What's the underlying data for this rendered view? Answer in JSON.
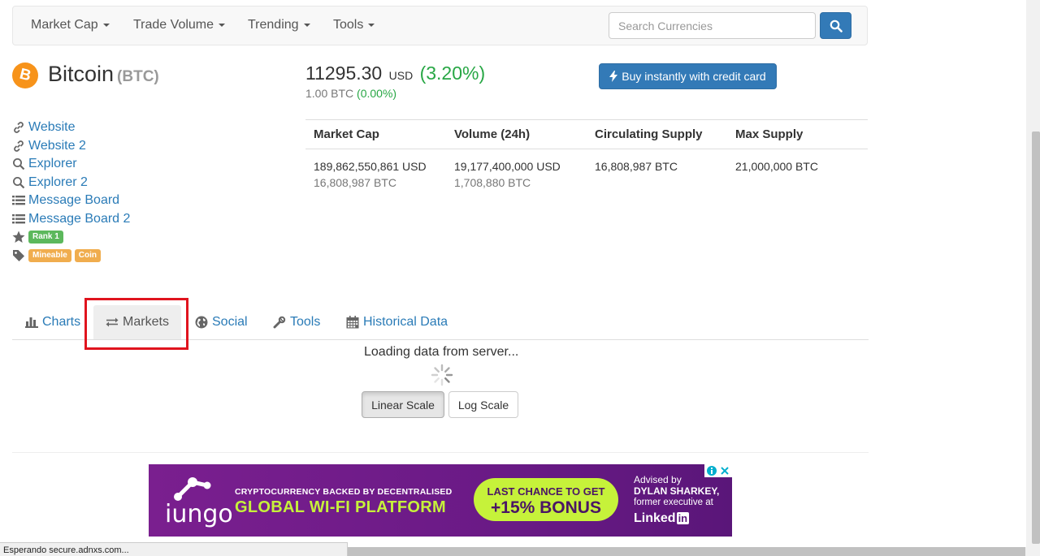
{
  "navbar": {
    "items": [
      {
        "label": "Market Cap"
      },
      {
        "label": "Trade Volume"
      },
      {
        "label": "Trending"
      },
      {
        "label": "Tools"
      }
    ],
    "search_placeholder": "Search Currencies"
  },
  "coin": {
    "name": "Bitcoin",
    "symbol": "(BTC)",
    "logo_color": "#f7931a"
  },
  "links": [
    {
      "label": "Website",
      "icon": "link-icon"
    },
    {
      "label": "Website 2",
      "icon": "link-icon"
    },
    {
      "label": "Explorer",
      "icon": "search-icon"
    },
    {
      "label": "Explorer 2",
      "icon": "search-icon"
    },
    {
      "label": "Message Board",
      "icon": "list-icon"
    },
    {
      "label": "Message Board 2",
      "icon": "list-icon"
    }
  ],
  "badges": {
    "rank": "Rank 1",
    "tags": [
      "Mineable",
      "Coin"
    ]
  },
  "price": {
    "value": "11295.30",
    "currency": "USD",
    "change": "(3.20%)",
    "btc_value": "1.00 BTC",
    "btc_change": "(0.00%)"
  },
  "buy_button": "Buy instantly with credit card",
  "stats": {
    "headers": [
      "Market Cap",
      "Volume (24h)",
      "Circulating Supply",
      "Max Supply"
    ],
    "market_cap_usd": "189,862,550,861 USD",
    "market_cap_btc": "16,808,987 BTC",
    "volume_usd": "19,177,400,000 USD",
    "volume_btc": "1,708,880 BTC",
    "circulating": "16,808,987 BTC",
    "max_supply": "21,000,000 BTC"
  },
  "tabs": [
    {
      "label": "Charts",
      "icon": "bar-chart-icon"
    },
    {
      "label": "Markets",
      "icon": "exchange-icon",
      "active": true
    },
    {
      "label": "Social",
      "icon": "globe-icon"
    },
    {
      "label": "Tools",
      "icon": "wrench-icon"
    },
    {
      "label": "Historical Data",
      "icon": "calendar-icon"
    }
  ],
  "loading_text": "Loading data from server...",
  "scale_buttons": {
    "linear": "Linear Scale",
    "log": "Log Scale"
  },
  "ad": {
    "brand": "iungo",
    "line1": "CRYPTOCURRENCY BACKED BY DECENTRALISED",
    "line2": "GLOBAL WI-FI PLATFORM",
    "pill1": "LAST CHANCE TO GET",
    "pill2": "+15% BONUS",
    "right1": "Advised by",
    "right2": "DYLAN SHARKEY,",
    "right3": "former executive at",
    "right4": "Linked",
    "right4_in": "in"
  },
  "status_text": "Esperando secure.adnxs.com...",
  "colors": {
    "link": "#2a7bb7",
    "primary": "#337ab7",
    "positive": "#28a745",
    "highlight": "#e0141e"
  }
}
